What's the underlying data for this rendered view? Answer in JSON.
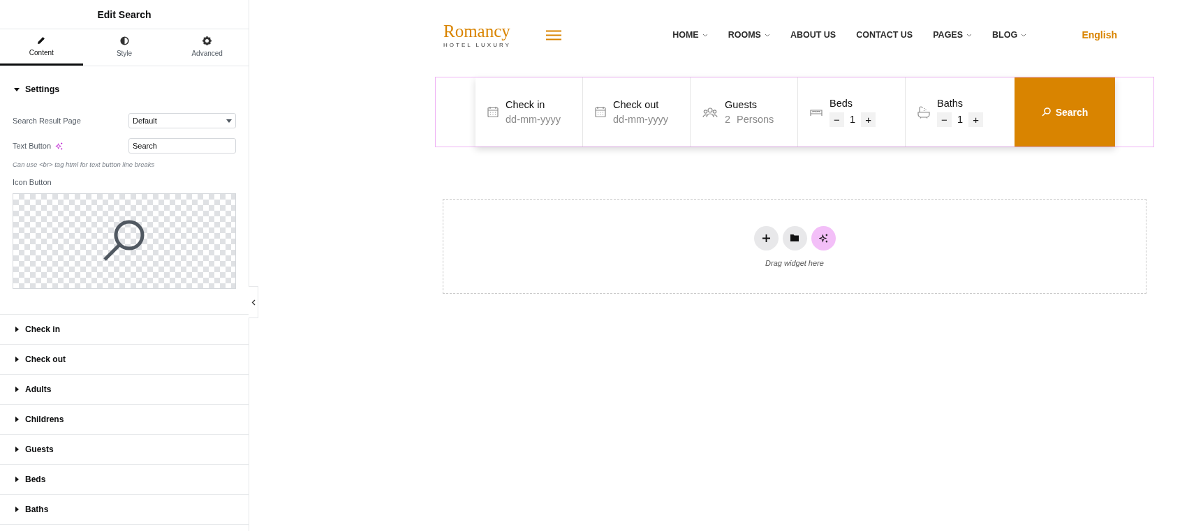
{
  "panel": {
    "title": "Edit Search",
    "tabs": [
      {
        "label": "Content",
        "selected": true
      },
      {
        "label": "Style",
        "selected": false
      },
      {
        "label": "Advanced",
        "selected": false
      }
    ],
    "settings": {
      "title": "Settings",
      "expanded": true,
      "search_result_page": {
        "label": "Search Result Page",
        "value": "Default"
      },
      "text_button": {
        "label": "Text Button",
        "value": "Search"
      },
      "hint": "Can use <br> tag html for text button line breaks",
      "icon_button": {
        "label": "Icon Button"
      }
    },
    "sections": [
      {
        "title": "Check in",
        "expanded": false
      },
      {
        "title": "Check out",
        "expanded": false
      },
      {
        "title": "Adults",
        "expanded": false
      },
      {
        "title": "Childrens",
        "expanded": false
      },
      {
        "title": "Guests",
        "expanded": false
      },
      {
        "title": "Beds",
        "expanded": false
      },
      {
        "title": "Baths",
        "expanded": false
      }
    ]
  },
  "site": {
    "logo": {
      "name": "Romancy",
      "tagline": "HOTEL LUXURY"
    },
    "nav": [
      {
        "label": "HOME",
        "dropdown": true
      },
      {
        "label": "ROOMS",
        "dropdown": true
      },
      {
        "label": "ABOUT US",
        "dropdown": false
      },
      {
        "label": "CONTACT US",
        "dropdown": false
      },
      {
        "label": "PAGES",
        "dropdown": true
      },
      {
        "label": "BLOG",
        "dropdown": true
      }
    ],
    "language": "English"
  },
  "search_form": {
    "fields": [
      {
        "kind": "date",
        "label": "Check in",
        "placeholder": "dd-mm-yyyy"
      },
      {
        "kind": "date",
        "label": "Check out",
        "placeholder": "dd-mm-yyyy"
      },
      {
        "kind": "guests",
        "label": "Guests",
        "value": "2",
        "unit": "Persons"
      },
      {
        "kind": "beds",
        "label": "Beds",
        "minus": "−",
        "value": "1",
        "plus": "+"
      },
      {
        "kind": "baths",
        "label": "Baths",
        "minus": "−",
        "value": "1",
        "plus": "+"
      }
    ],
    "button": "Search"
  },
  "dropzone": {
    "hint": "Drag widget here"
  }
}
